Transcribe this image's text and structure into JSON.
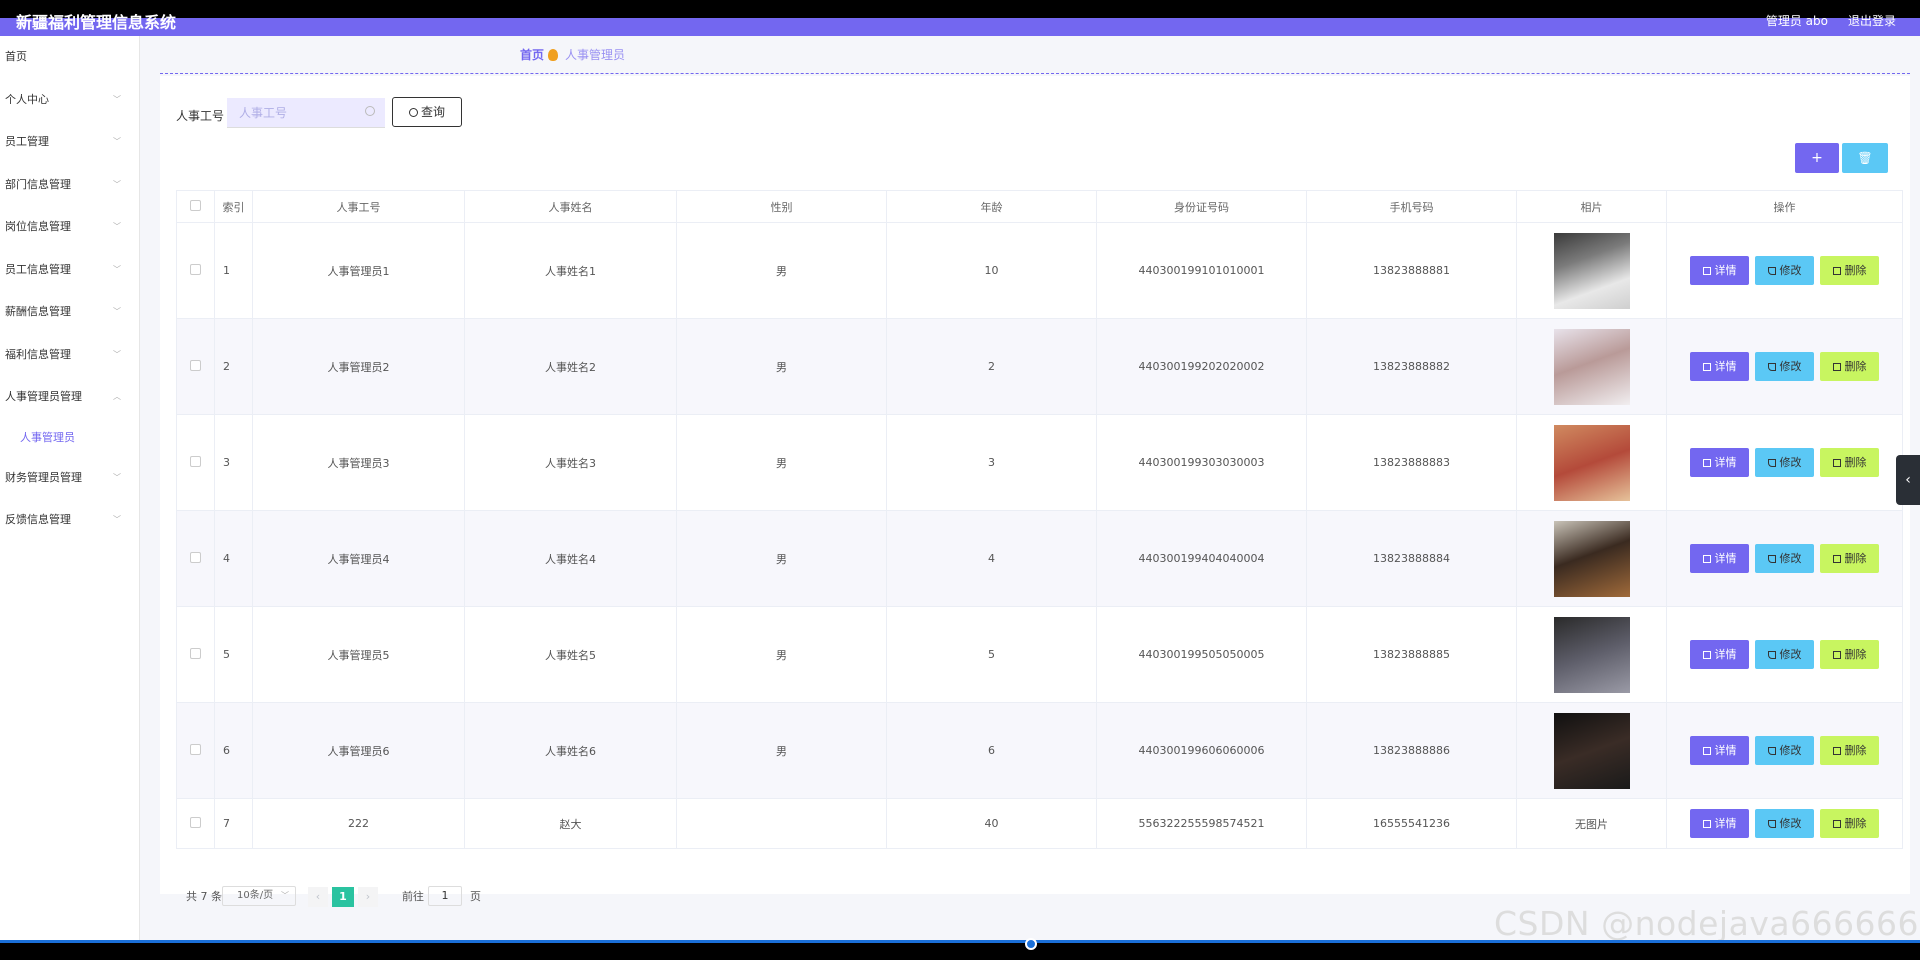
{
  "app": {
    "title": "新疆福利管理信息系统",
    "user_label": "管理员 abo",
    "logout_label": "退出登录"
  },
  "sidebar": {
    "items": [
      {
        "label": "首页",
        "has_arrow": false
      },
      {
        "label": "个人中心",
        "has_arrow": true
      },
      {
        "label": "员工管理",
        "has_arrow": true
      },
      {
        "label": "部门信息管理",
        "has_arrow": true
      },
      {
        "label": "岗位信息管理",
        "has_arrow": true
      },
      {
        "label": "员工信息管理",
        "has_arrow": true
      },
      {
        "label": "薪酬信息管理",
        "has_arrow": true
      },
      {
        "label": "福利信息管理",
        "has_arrow": true
      },
      {
        "label": "人事管理员管理",
        "has_arrow": true,
        "expanded": true,
        "sub": "人事管理员"
      },
      {
        "label": "财务管理员管理",
        "has_arrow": true
      },
      {
        "label": "反馈信息管理",
        "has_arrow": true
      }
    ]
  },
  "breadcrumb": {
    "home": "首页",
    "current": "人事管理员"
  },
  "search": {
    "label": "人事工号",
    "placeholder": "人事工号",
    "button_label": "查询"
  },
  "toolbar": {
    "add_icon": "plus-icon",
    "delete_icon": "trash-icon"
  },
  "table": {
    "columns": [
      "索引",
      "人事工号",
      "人事姓名",
      "性别",
      "年龄",
      "身份证号码",
      "手机号码",
      "相片",
      "操作"
    ],
    "rows": [
      {
        "index": "1",
        "id": "人事管理员1",
        "name": "人事姓名1",
        "gender": "男",
        "age": "10",
        "id_card": "440300199101010001",
        "phone": "13823888881",
        "photo": "avatar-man-white-shirt"
      },
      {
        "index": "2",
        "id": "人事管理员2",
        "name": "人事姓名2",
        "gender": "男",
        "age": "2",
        "id_card": "440300199202020002",
        "phone": "13823888882",
        "photo": "avatar-woman-long-hair"
      },
      {
        "index": "3",
        "id": "人事管理员3",
        "name": "人事姓名3",
        "gender": "男",
        "age": "3",
        "id_card": "440300199303030003",
        "phone": "13823888883",
        "photo": "avatar-woman-red-tone"
      },
      {
        "index": "4",
        "id": "人事管理员4",
        "name": "人事姓名4",
        "gender": "男",
        "age": "4",
        "id_card": "440300199404040004",
        "phone": "13823888884",
        "photo": "avatar-woman-window"
      },
      {
        "index": "5",
        "id": "人事管理员5",
        "name": "人事姓名5",
        "gender": "男",
        "age": "5",
        "id_card": "440300199505050005",
        "phone": "13823888885",
        "photo": "avatar-man-dark"
      },
      {
        "index": "6",
        "id": "人事管理员6",
        "name": "人事姓名6",
        "gender": "男",
        "age": "6",
        "id_card": "440300199606060006",
        "phone": "13823888886",
        "photo": "avatar-man-black"
      },
      {
        "index": "7",
        "id": "222",
        "name": "赵大",
        "gender": "",
        "age": "40",
        "id_card": "556322255598574521",
        "phone": "16555541236",
        "photo": "",
        "photo_text": "无图片"
      }
    ],
    "actions": {
      "detail": "详情",
      "edit": "修改",
      "delete": "删除"
    }
  },
  "pagination": {
    "total": "共 7 条",
    "page_size": "10条/页",
    "current_page": "1",
    "goto_label": "前往",
    "goto_value": "1",
    "page_suffix": "页"
  },
  "watermark": "CSDN @nodejava666666",
  "colors": {
    "primary": "#7367f0",
    "info": "#5bc8f5",
    "danger_bg": "#c8f560",
    "pager_active": "#2ac3a0"
  }
}
